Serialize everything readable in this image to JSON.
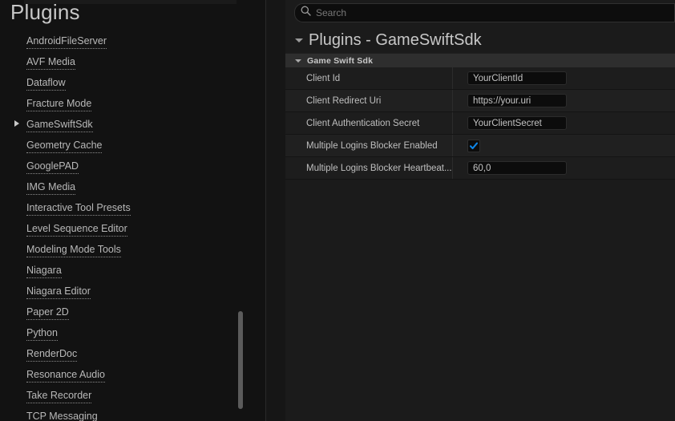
{
  "sidebar": {
    "title": "Plugins",
    "items": [
      {
        "label": "AndroidFileServer",
        "expandable": false,
        "selected": false
      },
      {
        "label": "AVF Media",
        "expandable": false,
        "selected": false
      },
      {
        "label": "Dataflow",
        "expandable": false,
        "selected": false
      },
      {
        "label": "Fracture Mode",
        "expandable": false,
        "selected": false
      },
      {
        "label": "GameSwiftSdk",
        "expandable": true,
        "selected": true
      },
      {
        "label": "Geometry Cache",
        "expandable": false,
        "selected": false
      },
      {
        "label": "GooglePAD",
        "expandable": false,
        "selected": false
      },
      {
        "label": "IMG Media",
        "expandable": false,
        "selected": false
      },
      {
        "label": "Interactive Tool Presets",
        "expandable": false,
        "selected": false
      },
      {
        "label": "Level Sequence Editor",
        "expandable": false,
        "selected": false
      },
      {
        "label": "Modeling Mode Tools",
        "expandable": false,
        "selected": false
      },
      {
        "label": "Niagara",
        "expandable": false,
        "selected": false
      },
      {
        "label": "Niagara Editor",
        "expandable": false,
        "selected": false
      },
      {
        "label": "Paper 2D",
        "expandable": false,
        "selected": false
      },
      {
        "label": "Python",
        "expandable": false,
        "selected": false
      },
      {
        "label": "RenderDoc",
        "expandable": false,
        "selected": false
      },
      {
        "label": "Resonance Audio",
        "expandable": false,
        "selected": false
      },
      {
        "label": "Take Recorder",
        "expandable": false,
        "selected": false
      },
      {
        "label": "TCP Messaging",
        "expandable": false,
        "selected": false
      }
    ],
    "expand_icon": "triangle-right-icon",
    "scrollbar": "vertical-scrollbar"
  },
  "details": {
    "search": {
      "placeholder": "Search",
      "value": "",
      "icon": "search-icon"
    },
    "panel_title": "Plugins - GameSwiftSdk",
    "panel_caret_icon": "caret-down-icon",
    "group": {
      "title": "Game Swift Sdk",
      "caret_icon": "caret-down-icon",
      "expanded": true
    },
    "properties": [
      {
        "label": "Client Id",
        "type": "text",
        "value": "YourClientId"
      },
      {
        "label": "Client Redirect Uri",
        "type": "text",
        "value": "https://your.uri"
      },
      {
        "label": "Client Authentication Secret",
        "type": "text",
        "value": "YourClientSecret"
      },
      {
        "label": "Multiple Logins Blocker Enabled",
        "type": "checkbox",
        "value": "checked"
      },
      {
        "label": "Multiple Logins Blocker Heartbeat...",
        "type": "text",
        "value": "60,0"
      }
    ]
  },
  "colors": {
    "background": "#121212",
    "panel_background": "#1b1b1b",
    "group_header": "#2e2e2e",
    "text": "#bfbfbf",
    "accent_check": "#0e86e8",
    "field_background": "#0c0c0c"
  }
}
